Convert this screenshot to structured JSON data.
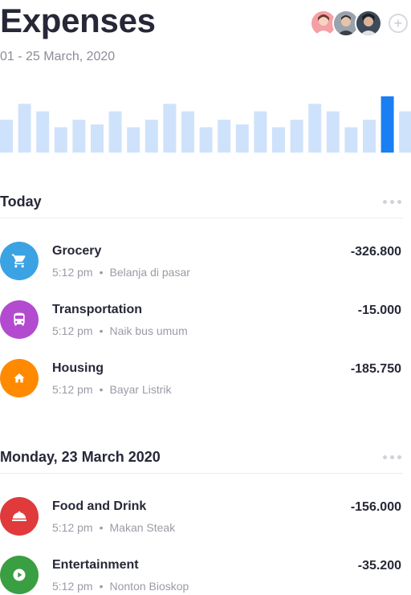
{
  "header": {
    "title": "Expenses",
    "date_range": "01 - 25 March, 2020",
    "add_label": "+"
  },
  "colors": {
    "bar": "#cfe2fb",
    "bar_active": "#1a7ff2",
    "grocery": "#3ba3e4",
    "transportation": "#b24bd0",
    "housing": "#ff8a00",
    "food": "#e03a3c",
    "entertainment": "#3a9e43"
  },
  "chart_data": {
    "type": "bar",
    "title": "",
    "xlabel": "",
    "ylabel": "",
    "ylim": [
      0,
      60
    ],
    "values": [
      35,
      52,
      44,
      27,
      35,
      30,
      44,
      27,
      35,
      52,
      44,
      27,
      35,
      30,
      44,
      27,
      35,
      52,
      44,
      27,
      35,
      60,
      44
    ],
    "highlight_index": 21
  },
  "sections": [
    {
      "title": "Today",
      "items": [
        {
          "icon": "cart-icon",
          "name": "Grocery",
          "time": "5:12 pm",
          "note": "Belanja di pasar",
          "amount": "-326.800",
          "color": "#3ba3e4"
        },
        {
          "icon": "bus-icon",
          "name": "Transportation",
          "time": "5:12 pm",
          "note": "Naik bus umum",
          "amount": "-15.000",
          "color": "#b24bd0"
        },
        {
          "icon": "home-icon",
          "name": "Housing",
          "time": "5:12 pm",
          "note": "Bayar Listrik",
          "amount": "-185.750",
          "color": "#ff8a00"
        }
      ]
    },
    {
      "title": "Monday, 23 March 2020",
      "items": [
        {
          "icon": "food-cloche-icon",
          "name": "Food and Drink",
          "time": "5:12 pm",
          "note": "Makan Steak",
          "amount": "-156.000",
          "color": "#e03a3c"
        },
        {
          "icon": "play-icon",
          "name": "Entertainment",
          "time": "5:12 pm",
          "note": "Nonton Bioskop",
          "amount": "-35.200",
          "color": "#3a9e43"
        }
      ]
    }
  ]
}
